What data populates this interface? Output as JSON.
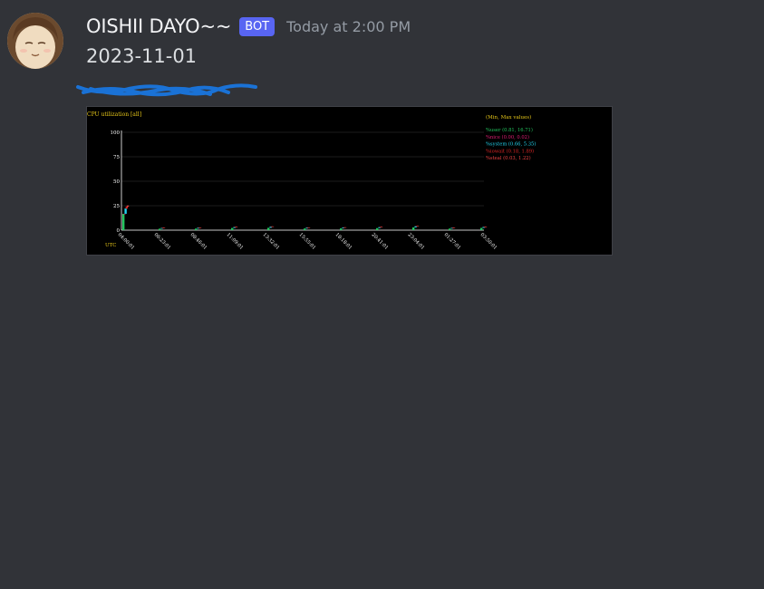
{
  "message": {
    "author": "OISHII DAYO~~",
    "badge": "BOT",
    "timestamp": "Today at 2:00 PM",
    "content": "2023-11-01"
  },
  "attachment": {
    "title": "CPU utilization [all]",
    "legend_title": "(Min, Max values)",
    "legend": [
      {
        "label": "%user (0.81, 16.71)",
        "color": "#22c55e"
      },
      {
        "label": "%nice (0.00, 0.02)",
        "color": "#e11d74"
      },
      {
        "label": "%system (0.66, 5.35)",
        "color": "#22d3ee"
      },
      {
        "label": "%iowait (0.18, 1.89)",
        "color": "#dc2626"
      },
      {
        "label": "%steal (0.03, 1.22)",
        "color": "#ef4444"
      }
    ],
    "y_ticks": [
      "100",
      "75",
      "50",
      "25",
      "0"
    ],
    "x_ticks": [
      "04:00:01",
      "06:23:01",
      "08:46:01",
      "11:09:01",
      "13:32:01",
      "15:55:01",
      "18:18:01",
      "20:41:01",
      "23:04:01",
      "01:27:01",
      "03:50:01"
    ],
    "timezone": "UTC"
  },
  "chart_data": {
    "type": "bar",
    "title": "CPU utilization [all]",
    "ylim": [
      0,
      100
    ],
    "grid": true,
    "legend_position": "top-right",
    "categories": [
      "04:00:01",
      "06:23:01",
      "08:46:01",
      "11:09:01",
      "13:32:01",
      "15:55:01",
      "18:18:01",
      "20:41:01",
      "23:04:01",
      "01:27:01",
      "03:50:01"
    ],
    "series": [
      {
        "name": "%user",
        "values": [
          16.7,
          1.5,
          1.6,
          2.2,
          2.4,
          1.7,
          1.8,
          2.1,
          2.8,
          1.6,
          2.3
        ]
      },
      {
        "name": "%nice",
        "values": [
          0.02,
          0,
          0,
          0,
          0,
          0,
          0,
          0,
          0,
          0,
          0
        ]
      },
      {
        "name": "%system",
        "values": [
          5.35,
          0.8,
          0.9,
          1.0,
          1.1,
          0.9,
          0.9,
          1.0,
          1.2,
          0.8,
          1.0
        ]
      },
      {
        "name": "%iowait",
        "values": [
          1.89,
          0.2,
          0.2,
          0.3,
          0.3,
          0.2,
          0.2,
          0.3,
          0.3,
          0.2,
          0.2
        ]
      },
      {
        "name": "%steal",
        "values": [
          1.22,
          0.05,
          0.05,
          0.05,
          0.05,
          0.05,
          0.05,
          0.05,
          0.05,
          0.05,
          0.05
        ]
      }
    ]
  }
}
